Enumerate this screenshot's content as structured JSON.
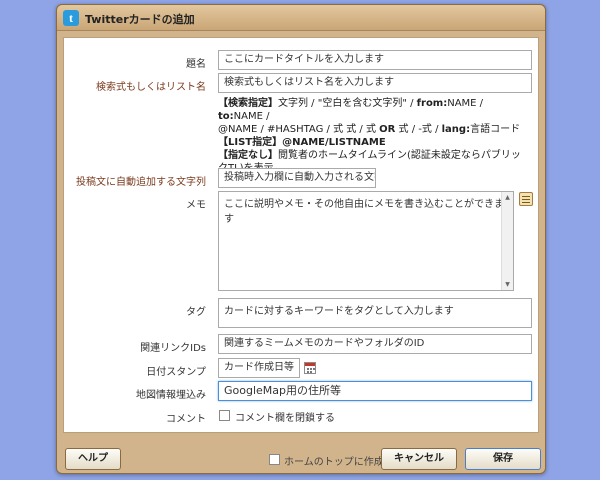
{
  "dialog": {
    "title": "Twitterカードの追加",
    "title_icon": "twitter-icon"
  },
  "form": {
    "title_label": "題名",
    "title_placeholder": "ここにカードタイトルを入力します",
    "query_label": "検索式もしくはリスト名",
    "query_placeholder": "検索式もしくはリスト名を入力します",
    "help": {
      "line1_tag": "【検索指定】",
      "line1_text": "文字列 / \"空白を含む文字列\" / ",
      "line1_from": "from:",
      "line1_from_val": "NAME / ",
      "line1_to": "to:",
      "line1_to_val": "NAME /",
      "line2": "@NAME / #HASHTAG / 式 式 / 式 ",
      "line2_or": "OR",
      "line2_rest": " 式 / -式 / ",
      "line2_lang": "lang:",
      "line2_lang_val": "言語コード",
      "line3_tag": "【LIST指定】",
      "line3_text": "@NAME/LISTNAME",
      "line4_tag": "【指定なし】",
      "line4_text": "閲覧者のホームタイムライン(認証未設定ならパブリックTL)を表示"
    },
    "auto_label": "投稿文に自動追加する文字列",
    "auto_placeholder": "投稿時入力欄に自動入力される文字列",
    "memo_label": "メモ",
    "memo_placeholder": "ここに説明やメモ・その他自由にメモを書き込むことができます",
    "memo_icon": "notepad-icon",
    "tag_label": "タグ",
    "tag_placeholder": "カードに対するキーワードをタグとして入力します",
    "link_label": "関連リンクIDs",
    "link_placeholder": "関連するミームメモのカードやフォルダのID",
    "date_label": "日付スタンプ",
    "date_placeholder": "カード作成日等",
    "date_icon": "calendar-icon",
    "map_label": "地図情報埋込み",
    "map_value": "GoogleMap用の住所等",
    "comment_label": "コメント",
    "comment_checkbox_label": "コメント欄を閉鎖する"
  },
  "footer": {
    "help_button": "ヘルプ",
    "home_top_checkbox": "ホームのトップに作成",
    "cancel_button": "キャンセル",
    "save_button": "保存"
  },
  "colors": {
    "background": "#8fa4e6",
    "dialog_frame": "#d2b48c",
    "focus_border": "#4a90d9"
  }
}
